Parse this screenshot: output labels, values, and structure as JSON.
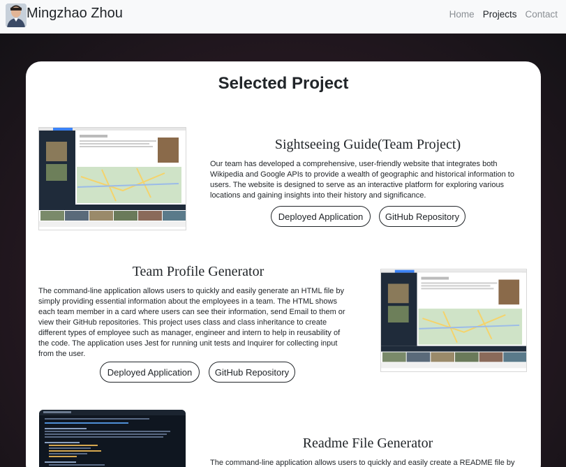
{
  "navbar": {
    "brand": "Mingzhao Zhou",
    "links": [
      "Home",
      "Projects",
      "Contact"
    ]
  },
  "main": {
    "title": "Selected Project"
  },
  "projects": [
    {
      "title": "Sightseeing Guide(Team Project)",
      "description": "Our team has developed a comprehensive, user-friendly website that integrates both Wikipedia and Google APIs to provide a wealth of geographic and historical information to users. The website is designed to serve as an interactive platform for exploring various locations and gaining insights into their history and significance.",
      "deployed_label": "Deployed Application",
      "github_label": "GitHub Repository"
    },
    {
      "title": "Team Profile Generator",
      "description": "The command-line application allows users to quickly and easily generate an HTML file by simply providing essential information about the employees in a team. The HTML shows each team member in a card where users can see their information, send Email to them or view their GitHub repositories. This project uses class and class inheritance to create different types of employee such as manager, engineer and intern to help in reusability of the code. The application uses Jest for running unit tests and Inquirer for collecting input from the user.",
      "deployed_label": "Deployed Application",
      "github_label": "GitHub Repository"
    },
    {
      "title": "Readme File Generator",
      "description": "The command-line application allows users to quickly and easily create a README file by"
    }
  ],
  "colors": {
    "navbar_bg": "#f8f9fa",
    "card_bg": "#ffffff",
    "page_bg": "#1c1a1f"
  }
}
